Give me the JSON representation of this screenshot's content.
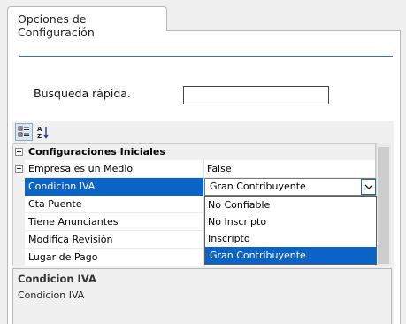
{
  "tab": {
    "label": "Opciones de Configuración"
  },
  "search": {
    "label": "Busqueda rápida.",
    "value": "",
    "placeholder": ""
  },
  "grid": {
    "category": {
      "label": "Configuraciones Iniciales",
      "expander": "−"
    },
    "rows": [
      {
        "name": "Empresa es un Medio",
        "value": "False",
        "expander": "+"
      },
      {
        "name": "Condicion IVA",
        "value": "Gran Contribuyente"
      },
      {
        "name": "Cta Puente",
        "value": ""
      },
      {
        "name": "Tiene Anunciantes",
        "value": ""
      },
      {
        "name": "Modifica Revisión",
        "value": ""
      },
      {
        "name": "Lugar de Pago",
        "value": ""
      }
    ],
    "dropdown_options": [
      {
        "label": "No Confiable",
        "selected": false
      },
      {
        "label": "No Inscripto",
        "selected": false
      },
      {
        "label": "Inscripto",
        "selected": false
      },
      {
        "label": "Gran Contribuyente",
        "selected": true
      }
    ]
  },
  "help": {
    "title": "Condicion IVA",
    "description": "Condicion IVA"
  },
  "colors": {
    "selection": "#0a64c8",
    "divider": "#2e74c2"
  },
  "icons": {
    "toolbar": [
      "categorized-icon",
      "alphabetical-sort-icon"
    ],
    "combo": "chevron-down-icon"
  }
}
